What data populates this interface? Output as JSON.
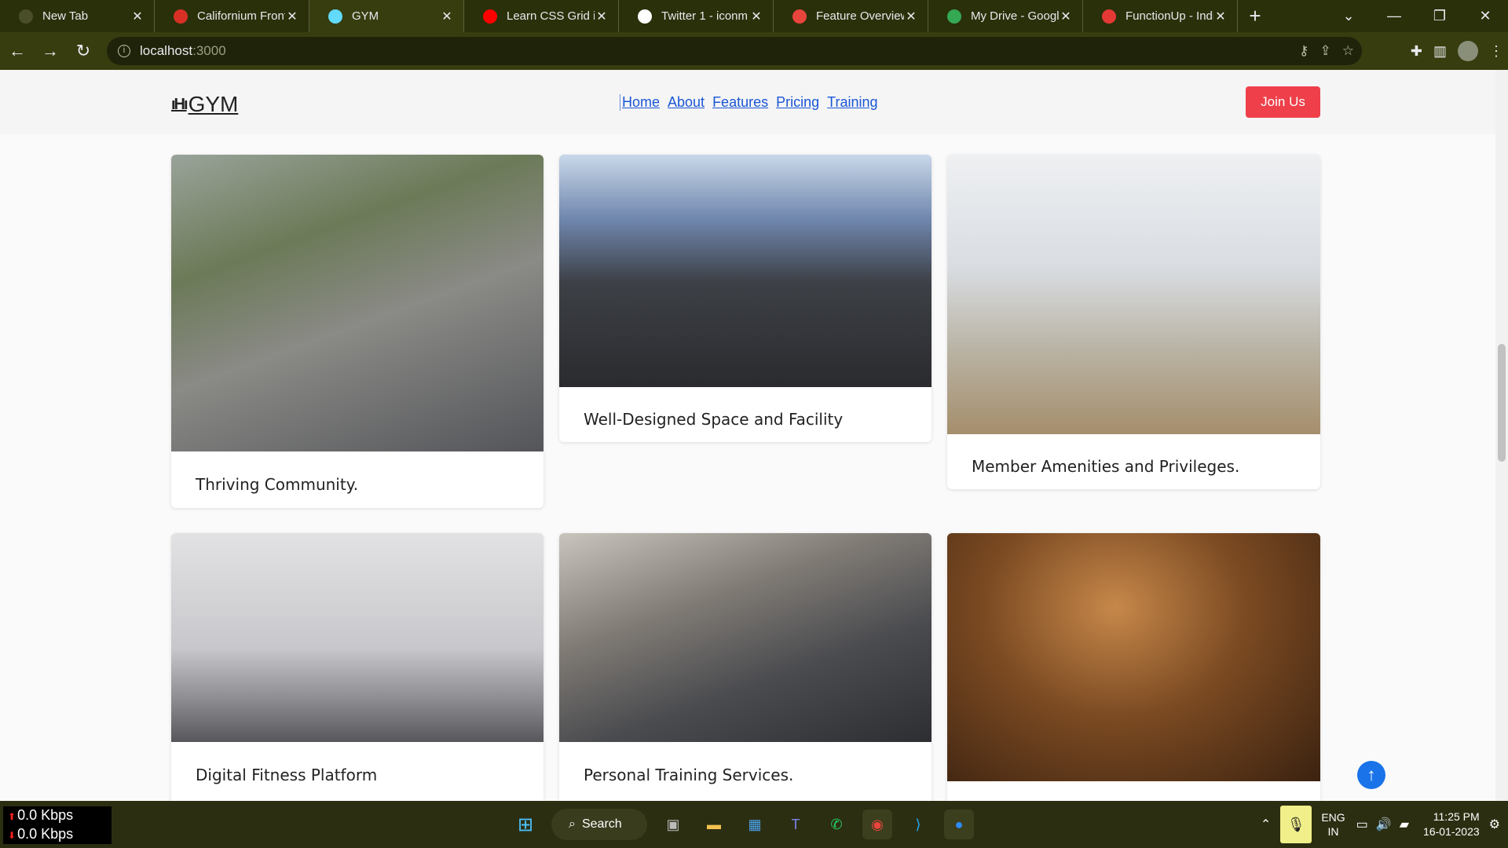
{
  "browser": {
    "tabs": [
      {
        "title": "New Tab",
        "favicon": "chrome-icon",
        "color": "#4a4f2a",
        "active": false
      },
      {
        "title": "Californium Front",
        "favicon": "gmail-icon",
        "color": "#d93025",
        "active": false
      },
      {
        "title": "GYM",
        "favicon": "react-icon",
        "color": "#61dafb",
        "active": true
      },
      {
        "title": "Learn CSS Grid in",
        "favicon": "youtube-icon",
        "color": "#ff0000",
        "active": false
      },
      {
        "title": "Twitter 1 - iconm",
        "favicon": "iconmonstr-icon",
        "color": "#ffffff",
        "active": false
      },
      {
        "title": "Feature Overview",
        "favicon": "feature-icon",
        "color": "#e8453c",
        "active": false
      },
      {
        "title": "My Drive - Googl",
        "favicon": "drive-icon",
        "color": "#34a853",
        "active": false
      },
      {
        "title": "FunctionUp - Indi",
        "favicon": "functionup-icon",
        "color": "#e53935",
        "active": false
      }
    ],
    "url_host": "localhost",
    "url_port": ":3000"
  },
  "site": {
    "logo_text": "GYM",
    "nav_links": [
      "Home",
      "About",
      "Features",
      "Pricing",
      "Training"
    ],
    "join_label": "Join Us",
    "accent": "#ee3f4a",
    "link_color": "#1a56d6"
  },
  "features": [
    {
      "caption": "Thriving Community.",
      "image": "runners-photo"
    },
    {
      "caption": "Well-Designed Space and Facility",
      "image": "gym-floor-photo"
    },
    {
      "caption": "Member Amenities and Privileges.",
      "image": "yoga-studio-photo"
    },
    {
      "caption": "Digital Fitness Platform",
      "image": "smart-gym-photo"
    },
    {
      "caption": "Personal Training Services.",
      "image": "trainers-photo"
    },
    {
      "caption": "",
      "image": "sauna-photo"
    }
  ],
  "taskbar": {
    "net_up": "0.0 Kbps",
    "net_down": "0.0 Kbps",
    "search_label": "Search",
    "lang_1": "ENG",
    "lang_2": "IN",
    "time": "11:25 PM",
    "date": "16-01-2023"
  }
}
